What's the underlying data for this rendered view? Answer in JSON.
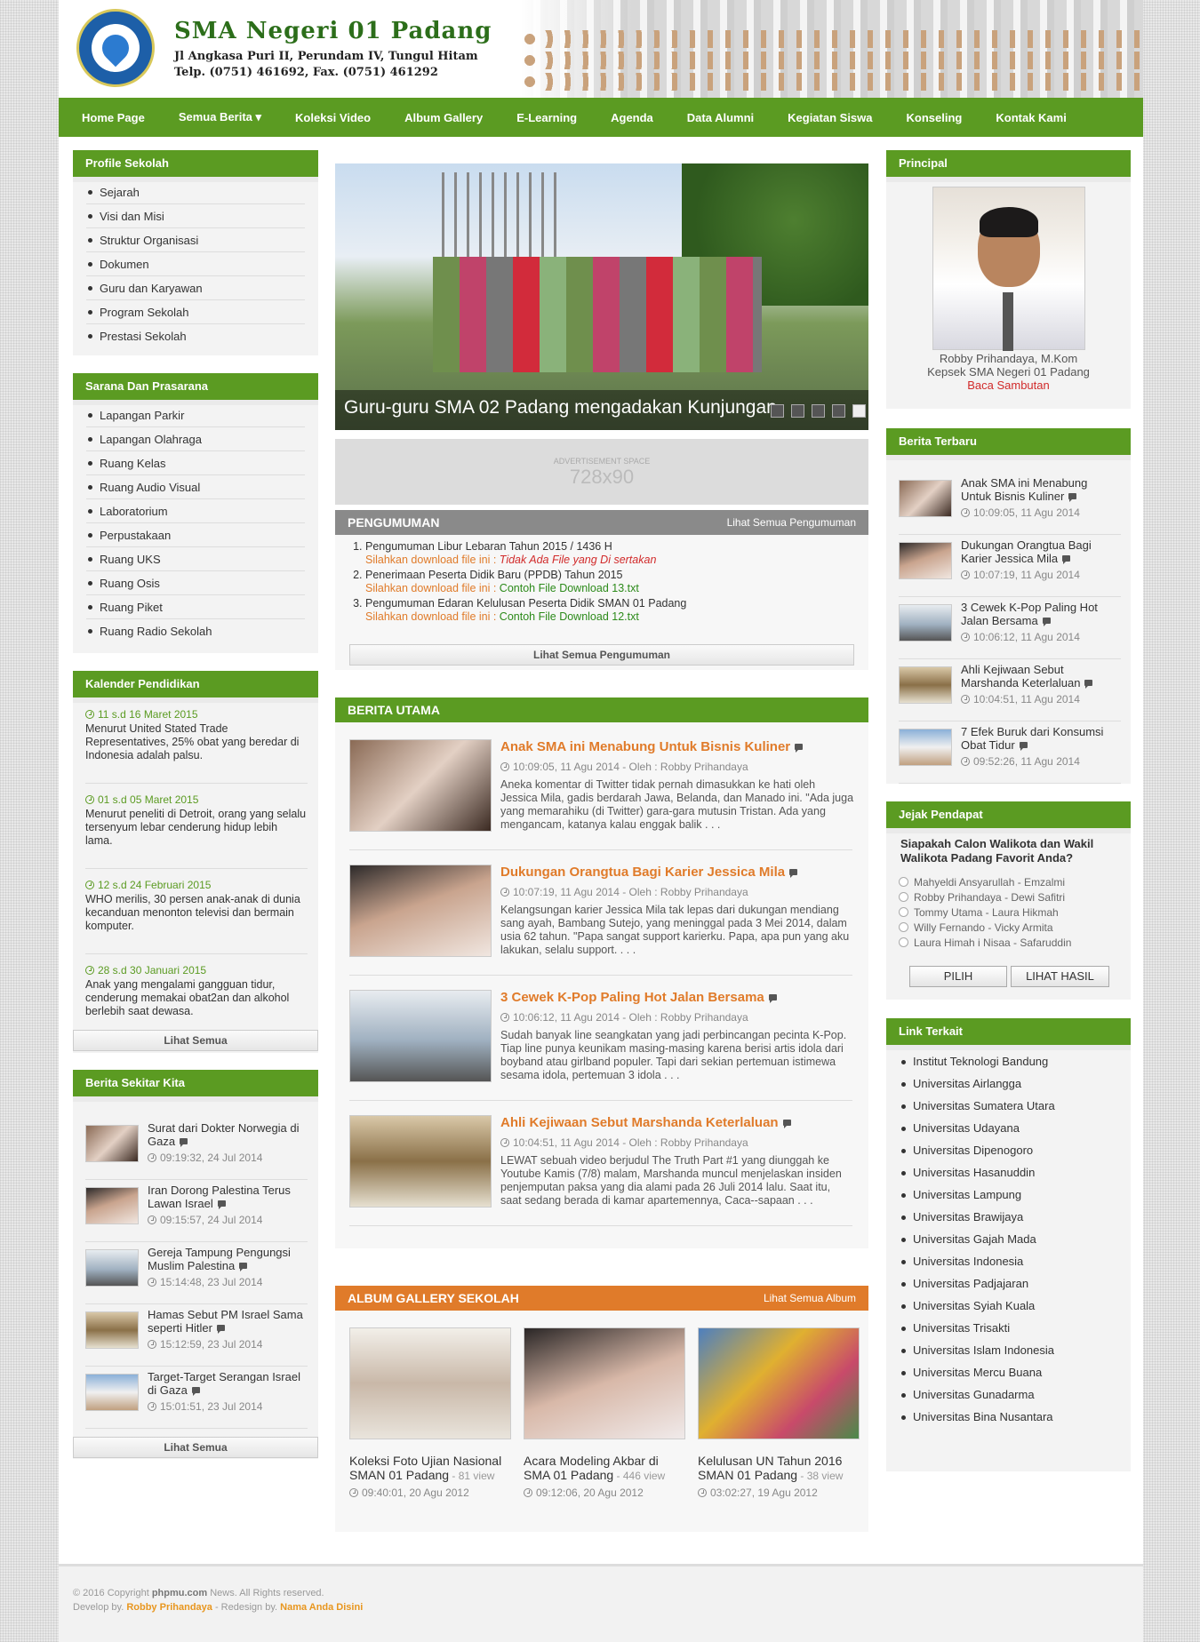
{
  "header": {
    "school_name": "SMA Negeri 01 Padang",
    "address": "Jl Angkasa Puri II, Perundam IV, Tungul Hitam",
    "phone": "Telp. (0751) 461692, Fax. (0751) 461292"
  },
  "nav": [
    "Home Page",
    "Semua Berita ▾",
    "Koleksi Video",
    "Album Gallery",
    "E-Learning",
    "Agenda",
    "Data Alumni",
    "Kegiatan Siswa",
    "Konseling",
    "Kontak Kami"
  ],
  "profile": {
    "title": "Profile Sekolah",
    "items": [
      "Sejarah",
      "Visi dan Misi",
      "Struktur Organisasi",
      "Dokumen",
      "Guru dan Karyawan",
      "Program Sekolah",
      "Prestasi Sekolah"
    ]
  },
  "sarana": {
    "title": "Sarana Dan Prasarana",
    "items": [
      "Lapangan Parkir",
      "Lapangan Olahraga",
      "Ruang Kelas",
      "Ruang Audio Visual",
      "Laboratorium",
      "Perpustakaan",
      "Ruang UKS",
      "Ruang Osis",
      "Ruang Piket",
      "Ruang Radio Sekolah"
    ]
  },
  "kalender": {
    "title": "Kalender Pendidikan",
    "items": [
      {
        "date": "11 s.d 16 Maret 2015",
        "text": "Menurut United Stated Trade Representatives, 25% obat yang beredar di Indonesia adalah palsu."
      },
      {
        "date": "01 s.d 05 Maret 2015",
        "text": "Menurut peneliti di Detroit, orang yang selalu tersenyum lebar cenderung hidup lebih lama."
      },
      {
        "date": "12 s.d 24 Februari 2015",
        "text": "WHO merilis, 30 persen anak-anak di dunia kecanduan menonton televisi dan bermain komputer."
      },
      {
        "date": "28 s.d 30 Januari 2015",
        "text": "Anak yang mengalami gangguan tidur, cenderung memakai obat2an dan alkohol berlebih saat dewasa."
      }
    ],
    "button": "Lihat Semua"
  },
  "sekitar": {
    "title": "Berita Sekitar Kita",
    "items": [
      {
        "title": "Surat dari Dokter Norwegia di Gaza",
        "date": "09:19:32, 24 Jul 2014"
      },
      {
        "title": "Iran Dorong Palestina Terus Lawan Israel",
        "date": "09:15:57, 24 Jul 2014"
      },
      {
        "title": "Gereja Tampung Pengungsi Muslim Palestina",
        "date": "15:14:48, 23 Jul 2014"
      },
      {
        "title": "Hamas Sebut PM Israel Sama seperti Hitler",
        "date": "15:12:59, 23 Jul 2014"
      },
      {
        "title": "Target-Target Serangan Israel di Gaza",
        "date": "15:01:51, 23 Jul 2014"
      }
    ],
    "button": "Lihat Semua"
  },
  "slider": {
    "caption": "Guru-guru SMA 02 Padang mengadakan Kunjungan"
  },
  "ad": {
    "label": "ADVERTISEMENT SPACE",
    "size": "728x90"
  },
  "pengumuman": {
    "title": "PENGUMUMAN",
    "link": "Lihat Semua Pengumuman",
    "dl_label": "Silahkan download file ini : ",
    "items": [
      {
        "title": "Pengumuman Libur Lebaran Tahun 2015 / 1436 H",
        "file": "Tidak Ada File yang Di sertakan",
        "none": true
      },
      {
        "title": "Penerimaan Peserta Didik Baru (PPDB) Tahun 2015",
        "file": "Contoh File Download 13.txt",
        "none": false
      },
      {
        "title": "Pengumuman Edaran Kelulusan Peserta Didik SMAN 01 Padang",
        "file": "Contoh File Download 12.txt",
        "none": false
      }
    ],
    "button": "Lihat Semua Pengumuman"
  },
  "utama": {
    "title": "BERITA UTAMA",
    "items": [
      {
        "title": "Anak SMA ini Menabung Untuk Bisnis Kuliner",
        "meta": "10:09:05, 11 Agu 2014 - Oleh : Robby Prihandaya",
        "text": "Aneka komentar di Twitter tidak pernah dimasukkan ke hati oleh Jessica Mila, gadis berdarah Jawa, Belanda, dan Manado ini. \"Ada juga yang memarahiku (di Twitter) gara-gara mutusin Tristan. Ada yang mengancam, katanya kalau enggak balik . . ."
      },
      {
        "title": "Dukungan Orangtua Bagi Karier Jessica Mila",
        "meta": "10:07:19, 11 Agu 2014 - Oleh : Robby Prihandaya",
        "text": "Kelangsungan karier Jessica Mila tak lepas dari dukungan mendiang sang ayah, Bambang Sutejo, yang meninggal pada 3 Mei 2014, dalam usia 62 tahun.  \"Papa sangat support karierku. Papa, apa pun yang aku lakukan, selalu support. . . ."
      },
      {
        "title": "3 Cewek K-Pop Paling Hot Jalan Bersama",
        "meta": "10:06:12, 11 Agu 2014 - Oleh : Robby Prihandaya",
        "text": "Sudah banyak line seangkatan yang jadi perbincangan pecinta K-Pop. Tiap line punya keunikam masing-masing karena berisi artis idola dari boyband atau girlband populer.  Tapi dari sekian pertemuan  istimewa sesama idola, pertemuan 3 idola . . ."
      },
      {
        "title": "Ahli Kejiwaan Sebut Marshanda Keterlaluan",
        "meta": "10:04:51, 11 Agu 2014 - Oleh : Robby Prihandaya",
        "text": "LEWAT sebuah video berjudul The Truth Part #1 yang diunggah ke Youtube Kamis (7/8) malam, Marshanda muncul menjelaskan insiden penjemputan paksa yang dia alami pada 26 Juli 2014 lalu. Saat itu, saat sedang berada di kamar apartemennya, Caca--sapaan . . ."
      }
    ]
  },
  "album": {
    "title": "ALBUM GALLERY SEKOLAH",
    "link": "Lihat Semua Album",
    "items": [
      {
        "title": "Koleksi Foto Ujian Nasional SMAN 01 Padang",
        "views": " - 81 view",
        "date": "09:40:01, 20 Agu 2012"
      },
      {
        "title": "Acara Modeling Akbar di SMA 01 Padang",
        "views": " - 446 view",
        "date": "09:12:06, 20 Agu 2012"
      },
      {
        "title": "Kelulusan UN Tahun 2016 SMAN 01 Padang",
        "views": " - 38 view",
        "date": "03:02:27, 19 Agu 2012"
      }
    ]
  },
  "principal": {
    "title": "Principal",
    "name": "Robby Prihandaya, M.Kom",
    "position": "Kepsek SMA Negeri 01 Padang",
    "link": "Baca Sambutan"
  },
  "terbaru": {
    "title": "Berita Terbaru",
    "items": [
      {
        "title": "Anak SMA ini Menabung Untuk Bisnis Kuliner",
        "date": "10:09:05, 11 Agu 2014"
      },
      {
        "title": "Dukungan Orangtua Bagi Karier Jessica Mila",
        "date": "10:07:19, 11 Agu 2014"
      },
      {
        "title": "3 Cewek K-Pop Paling Hot Jalan Bersama",
        "date": "10:06:12, 11 Agu 2014"
      },
      {
        "title": "Ahli Kejiwaan Sebut Marshanda Keterlaluan",
        "date": "10:04:51, 11 Agu 2014"
      },
      {
        "title": "7 Efek Buruk dari Konsumsi Obat Tidur",
        "date": "09:52:26, 11 Agu 2014"
      }
    ]
  },
  "poll": {
    "title": "Jejak Pendapat",
    "question": "Siapakah Calon Walikota dan Wakil Walikota Padang Favorit Anda?",
    "options": [
      "Mahyeldi Ansyarullah - Emzalmi",
      "Robby Prihandaya - Dewi Safitri",
      "Tommy Utama - Laura Hikmah",
      "Willy Fernando - Vicky Armita",
      "Laura Himah i Nisaa - Safaruddin"
    ],
    "vote": "PILIH",
    "result": "LIHAT HASIL"
  },
  "links": {
    "title": "Link Terkait",
    "items": [
      "Institut Teknologi Bandung",
      "Universitas Airlangga",
      "Universitas Sumatera Utara",
      "Universitas Udayana",
      "Universitas Dipenogoro",
      "Universitas Hasanuddin",
      "Universitas Lampung",
      "Universitas Brawijaya",
      "Universitas Gajah Mada",
      "Universitas Indonesia",
      "Universitas Padjajaran",
      "Universitas Syiah Kuala",
      "Universitas Trisakti",
      "Universitas Islam Indonesia",
      "Universitas Mercu Buana",
      "Universitas Gunadarma",
      "Universitas Bina Nusantara"
    ]
  },
  "footer": {
    "copy": "© 2016 Copyright ",
    "site": "phpmu.com",
    "rest": " News. All Rights reserved.",
    "dev": "Develop by. ",
    "dev_name": "Robby Prihandaya",
    "redesign": " - Redesign by. ",
    "redesign_name": "Nama Anda Disini"
  },
  "colors": {
    "green": "#5b9b22",
    "orange": "#e07b2a",
    "gray_head": "#8a8a8a"
  }
}
